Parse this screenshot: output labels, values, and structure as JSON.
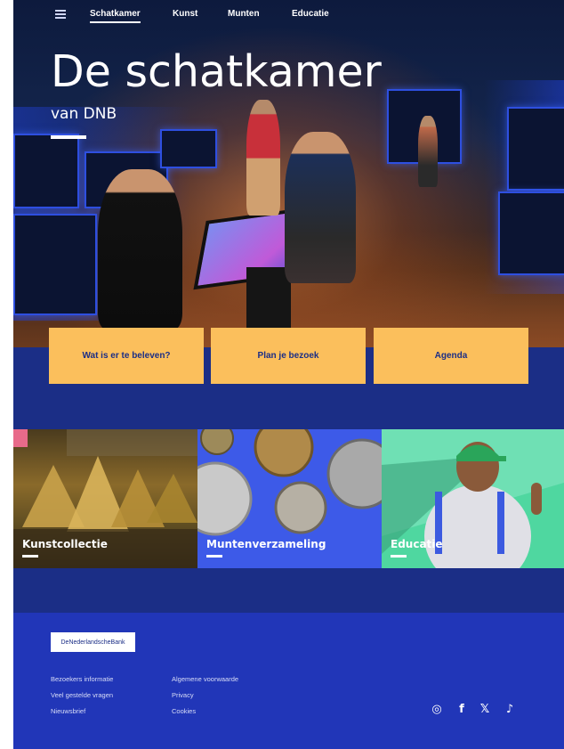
{
  "nav": {
    "items": [
      {
        "label": "Schatkamer",
        "active": true
      },
      {
        "label": "Kunst",
        "active": false
      },
      {
        "label": "Munten",
        "active": false
      },
      {
        "label": "Educatie",
        "active": false
      }
    ]
  },
  "hero": {
    "title": "De schatkamer",
    "subtitle": "van DNB"
  },
  "cta": {
    "experience": "Wat is er te beleven?",
    "plan": "Plan je bezoek",
    "agenda": "Agenda"
  },
  "tiles": {
    "kunst": "Kunstcollectie",
    "munten": "Muntenverzameling",
    "educatie": "Educatie"
  },
  "footer": {
    "logo_text": "DeNederlandscheBank",
    "col1": [
      "Bezoekers informatie",
      "Veel gestelde vragen",
      "Nieuwsbrief"
    ],
    "col2": [
      "Algemene voorwaarde",
      "Privacy",
      "Cookies"
    ],
    "social": {
      "instagram": "◎",
      "facebook": "f",
      "x": "𝕏",
      "tiktok": "♪"
    }
  },
  "colors": {
    "accent": "#fbbf5c",
    "navy": "#1b2e86",
    "footer": "#2136b8",
    "munten_tile": "#3d5ae8",
    "educatie_tile": "#4fd7a0"
  }
}
